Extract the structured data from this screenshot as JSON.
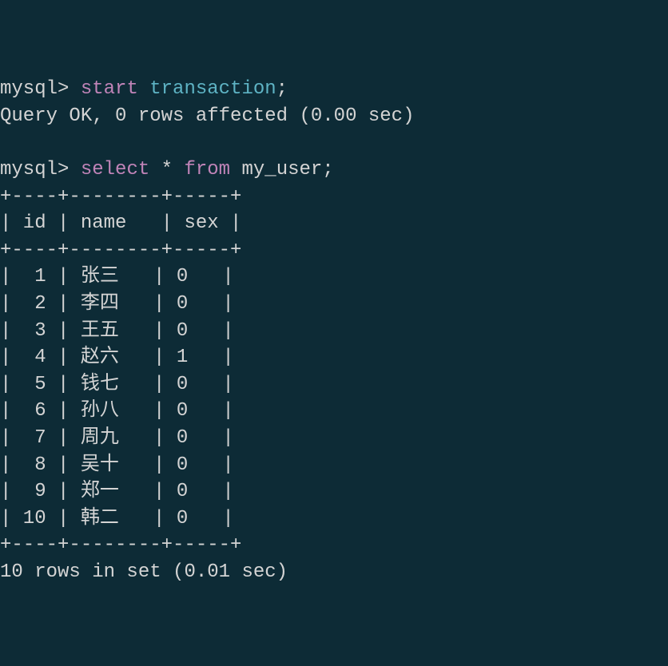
{
  "prompt1": "mysql> ",
  "command1": {
    "start": "start",
    "transaction": " transaction",
    "semi": ";"
  },
  "result1": "Query OK, 0 rows affected (0.00 sec)",
  "prompt2": "mysql> ",
  "command2": {
    "select": "select",
    "star": " * ",
    "from": "from",
    "table": " my_user",
    "semi": ";"
  },
  "table": {
    "border": "+----+--------+-----+",
    "header": "| id | name   | sex |",
    "rows": [
      "|  1 | 张三   | 0   |",
      "|  2 | 李四   | 0   |",
      "|  3 | 王五   | 0   |",
      "|  4 | 赵六   | 1   |",
      "|  5 | 钱七   | 0   |",
      "|  6 | 孙八   | 0   |",
      "|  7 | 周九   | 0   |",
      "|  8 | 吴十   | 0   |",
      "|  9 | 郑一   | 0   |",
      "| 10 | 韩二   | 0   |"
    ]
  },
  "result2": "10 rows in set (0.01 sec)"
}
